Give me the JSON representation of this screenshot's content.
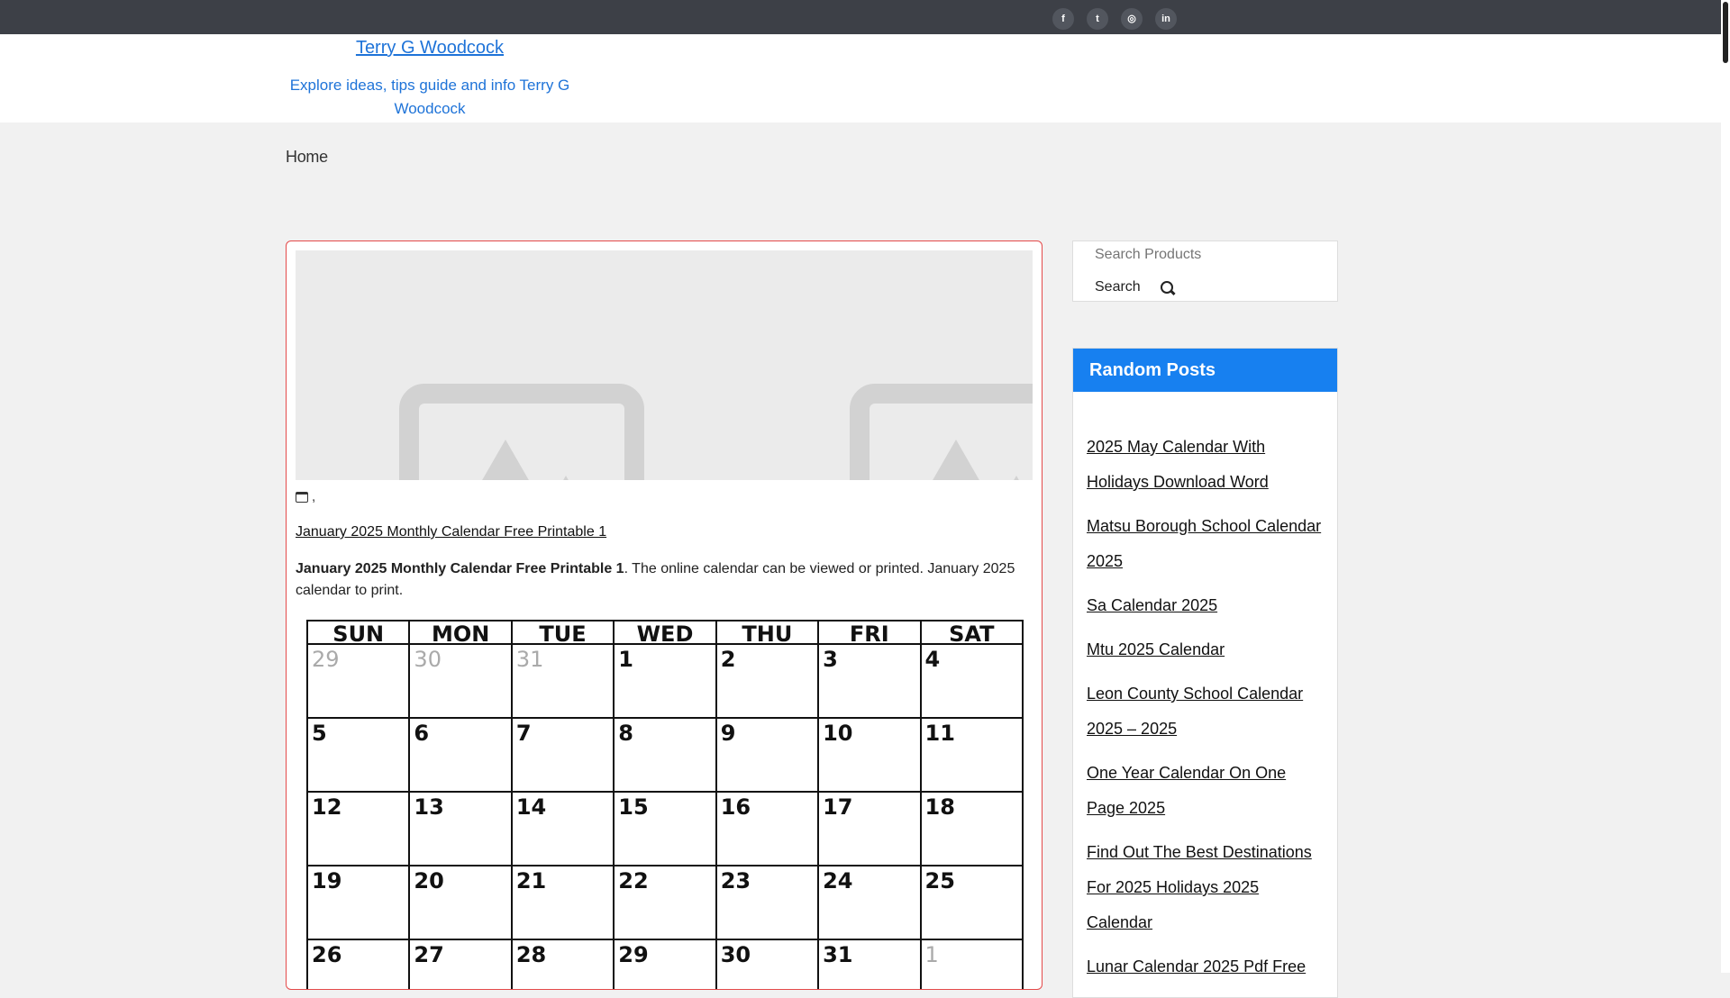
{
  "social": [
    "f",
    "t",
    "◎",
    "in"
  ],
  "site": {
    "title": "Terry G Woodcock",
    "tagline": "Explore ideas, tips guide and info Terry G Woodcock"
  },
  "nav": {
    "home": "Home"
  },
  "post": {
    "meta": ",",
    "title_link": "January 2025 Monthly Calendar Free Printable 1",
    "excerpt_bold": "January 2025 Monthly Calendar Free Printable 1",
    "excerpt_rest": ". The online calendar can be viewed or printed. January 2025 calendar to print."
  },
  "calendar": {
    "days": [
      "SUN",
      "MON",
      "TUE",
      "WED",
      "THU",
      "FRI",
      "SAT"
    ],
    "weeks": [
      [
        "29",
        "30",
        "31",
        "1",
        "2",
        "3",
        "4"
      ],
      [
        "5",
        "6",
        "7",
        "8",
        "9",
        "10",
        "11"
      ],
      [
        "12",
        "13",
        "14",
        "15",
        "16",
        "17",
        "18"
      ],
      [
        "19",
        "20",
        "21",
        "22",
        "23",
        "24",
        "25"
      ],
      [
        "26",
        "27",
        "28",
        "29",
        "30",
        "31",
        "1"
      ]
    ]
  },
  "search": {
    "placeholder": "Search Products",
    "button": "Search"
  },
  "random_posts": {
    "heading": "Random Posts",
    "items": [
      "2025 May Calendar With Holidays Download Word",
      "Matsu Borough School Calendar 2025",
      "Sa Calendar 2025",
      "Mtu 2025 Calendar",
      "Leon County School Calendar 2025 – 2025",
      "One Year Calendar On One Page 2025",
      "Find Out The Best Destinations For 2025 Holidays 2025 Calendar",
      "Lunar Calendar 2025 Pdf Free"
    ]
  }
}
